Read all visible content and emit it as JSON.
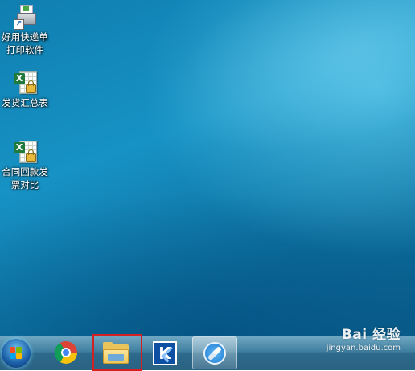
{
  "desktop": {
    "icons": [
      {
        "label_line1": "好用快递单",
        "label_line2": "打印软件",
        "icon": "printer-shortcut-icon"
      },
      {
        "label_line1": "发货汇总表",
        "label_line2": "",
        "icon": "excel-file-icon"
      },
      {
        "label_line1": "合同回款发",
        "label_line2": "票对比",
        "icon": "excel-file-icon"
      }
    ]
  },
  "taskbar": {
    "items": [
      {
        "name": "start-button",
        "icon": "windows-logo-icon"
      },
      {
        "name": "chrome",
        "icon": "chrome-icon"
      },
      {
        "name": "file-explorer",
        "icon": "folder-icon",
        "highlighted": true
      },
      {
        "name": "k-app",
        "icon": "k-app-icon",
        "glyph": "K"
      },
      {
        "name": "browser",
        "icon": "compass-icon",
        "active": true
      }
    ]
  },
  "watermark": {
    "logo": "Bai 经验",
    "paw": "🐾",
    "url": "jingyan.baidu.com"
  },
  "colors": {
    "highlight": "#d42020",
    "desktop": "#1286b8"
  }
}
